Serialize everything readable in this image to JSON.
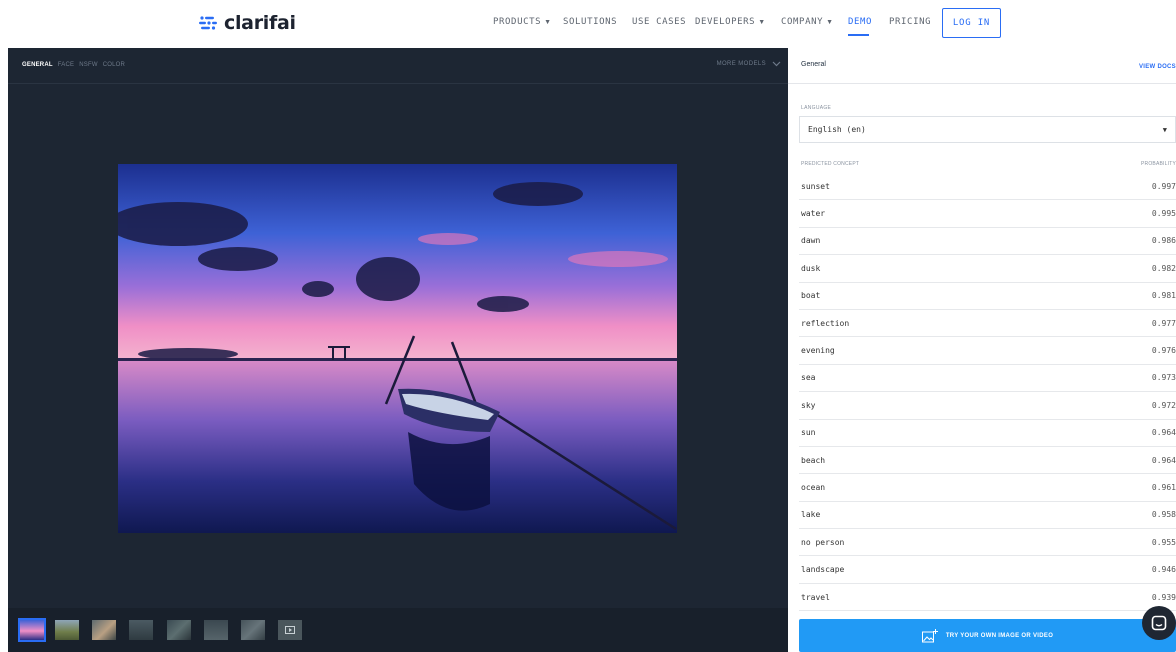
{
  "brand": {
    "name": "clarifai"
  },
  "nav": {
    "items": [
      {
        "label": "PRODUCTS",
        "dropdown": true
      },
      {
        "label": "SOLUTIONS",
        "dropdown": false
      },
      {
        "label": "USE CASES",
        "dropdown": false
      },
      {
        "label": "DEVELOPERS",
        "dropdown": true
      },
      {
        "label": "COMPANY",
        "dropdown": true
      },
      {
        "label": "DEMO",
        "dropdown": false,
        "active": true
      },
      {
        "label": "PRICING",
        "dropdown": false
      }
    ],
    "login": "LOG IN"
  },
  "models": {
    "tabs": [
      "GENERAL",
      "FACE",
      "NSFW",
      "COLOR"
    ],
    "active": "GENERAL",
    "more": "MORE MODELS"
  },
  "panel": {
    "title": "General",
    "view_docs": "VIEW DOCS",
    "language_label": "LANGUAGE",
    "language_value": "English (en)",
    "col_concept": "PREDICTED CONCEPT",
    "col_probability": "PROBABILITY",
    "concepts": [
      {
        "name": "sunset",
        "value": "0.997"
      },
      {
        "name": "water",
        "value": "0.995"
      },
      {
        "name": "dawn",
        "value": "0.986"
      },
      {
        "name": "dusk",
        "value": "0.982"
      },
      {
        "name": "boat",
        "value": "0.981"
      },
      {
        "name": "reflection",
        "value": "0.977"
      },
      {
        "name": "evening",
        "value": "0.976"
      },
      {
        "name": "sea",
        "value": "0.973"
      },
      {
        "name": "sky",
        "value": "0.972"
      },
      {
        "name": "sun",
        "value": "0.964"
      },
      {
        "name": "beach",
        "value": "0.964"
      },
      {
        "name": "ocean",
        "value": "0.961"
      },
      {
        "name": "lake",
        "value": "0.958"
      },
      {
        "name": "no person",
        "value": "0.955"
      },
      {
        "name": "landscape",
        "value": "0.946"
      },
      {
        "name": "travel",
        "value": "0.939"
      }
    ],
    "try_button": "TRY YOUR OWN IMAGE OR VIDEO"
  },
  "colors": {
    "accent": "#2a6df4",
    "button": "#219af5",
    "dark_panel": "#1d2633"
  }
}
